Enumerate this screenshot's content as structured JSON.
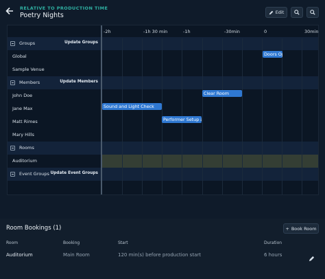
{
  "header": {
    "subtitle": "RELATIVE TO PRODUCTION TIME",
    "title": "Poetry Nights",
    "edit_label": "Edit"
  },
  "timeline": {
    "ticks": [
      "-2h",
      "-1h 30 min",
      "-1h",
      "-30min",
      "0",
      "30min"
    ],
    "rows": [
      {
        "label": "Groups",
        "type": "section",
        "action": "Update Groups"
      },
      {
        "label": "Global",
        "type": "item"
      },
      {
        "label": "Sample Venue",
        "type": "item"
      },
      {
        "label": "Members",
        "type": "section",
        "action": "Update Members"
      },
      {
        "label": "John Doe",
        "type": "item"
      },
      {
        "label": "Jane Max",
        "type": "item"
      },
      {
        "label": "Matt Rimes",
        "type": "item"
      },
      {
        "label": "Mary Hills",
        "type": "item"
      },
      {
        "label": "Rooms",
        "type": "section"
      },
      {
        "label": "Auditorium",
        "type": "item"
      },
      {
        "label": "Event Groups",
        "type": "section",
        "action": "Update Event Groups"
      }
    ],
    "events": [
      {
        "label": "Doors Op",
        "row": 1
      },
      {
        "label": "Clear Room",
        "row": 4
      },
      {
        "label": "Sound and Light Check",
        "row": 5
      },
      {
        "label": "Performer Setup a",
        "row": 6
      }
    ]
  },
  "bookings": {
    "title": "Room Bookings (1)",
    "book_label": "Book Room",
    "columns": [
      "Room",
      "Booking",
      "Start",
      "Duration"
    ],
    "rows": [
      {
        "room": "Auditorium",
        "booking": "Main Room",
        "start": "120 min(s) before production start",
        "duration": "6 hours"
      }
    ]
  }
}
